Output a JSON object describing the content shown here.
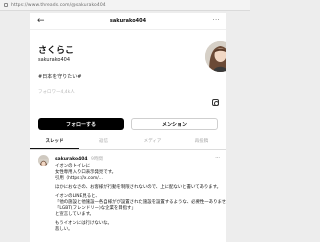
{
  "browser": {
    "url": "https://www.threads.com/@sakurako404"
  },
  "nav": {
    "back_icon": "←",
    "title": "sakurako404",
    "more_icon": "···"
  },
  "profile": {
    "display_name": "さくらこ",
    "username": "sakurako404",
    "bio": "#日本を守りたい#",
    "followers": "フォロワー4,4k人",
    "follow_label": "フォローする",
    "mention_label": "メンション"
  },
  "tabs": [
    "スレッド",
    "返信",
    "メディア",
    "再投稿"
  ],
  "post": {
    "username": "sakurako404",
    "time": "9時間",
    "more_icon": "···",
    "lines": [
      "イオンのトイレに",
      "女性専用入り口表示発見です。",
      "引用（https://x.com/...",
      "",
      "ほかにおなさの、お客様が行動を制限されないので、上に配ないと書いてあります。",
      "",
      "イオンのLINE見ると、",
      "「他の施設と他施設一各自様がが設置された施設を設置するような、必要性一ありません」",
      "「LGBT(フレンドリー)な企業を目指す」",
      "と宣言しています。",
      "",
      "もうイオンには行けないな。",
      "悲しい。"
    ]
  },
  "colors": {
    "accent": "#000000",
    "background": "#ffffff",
    "muted": "#a8a8a8"
  }
}
